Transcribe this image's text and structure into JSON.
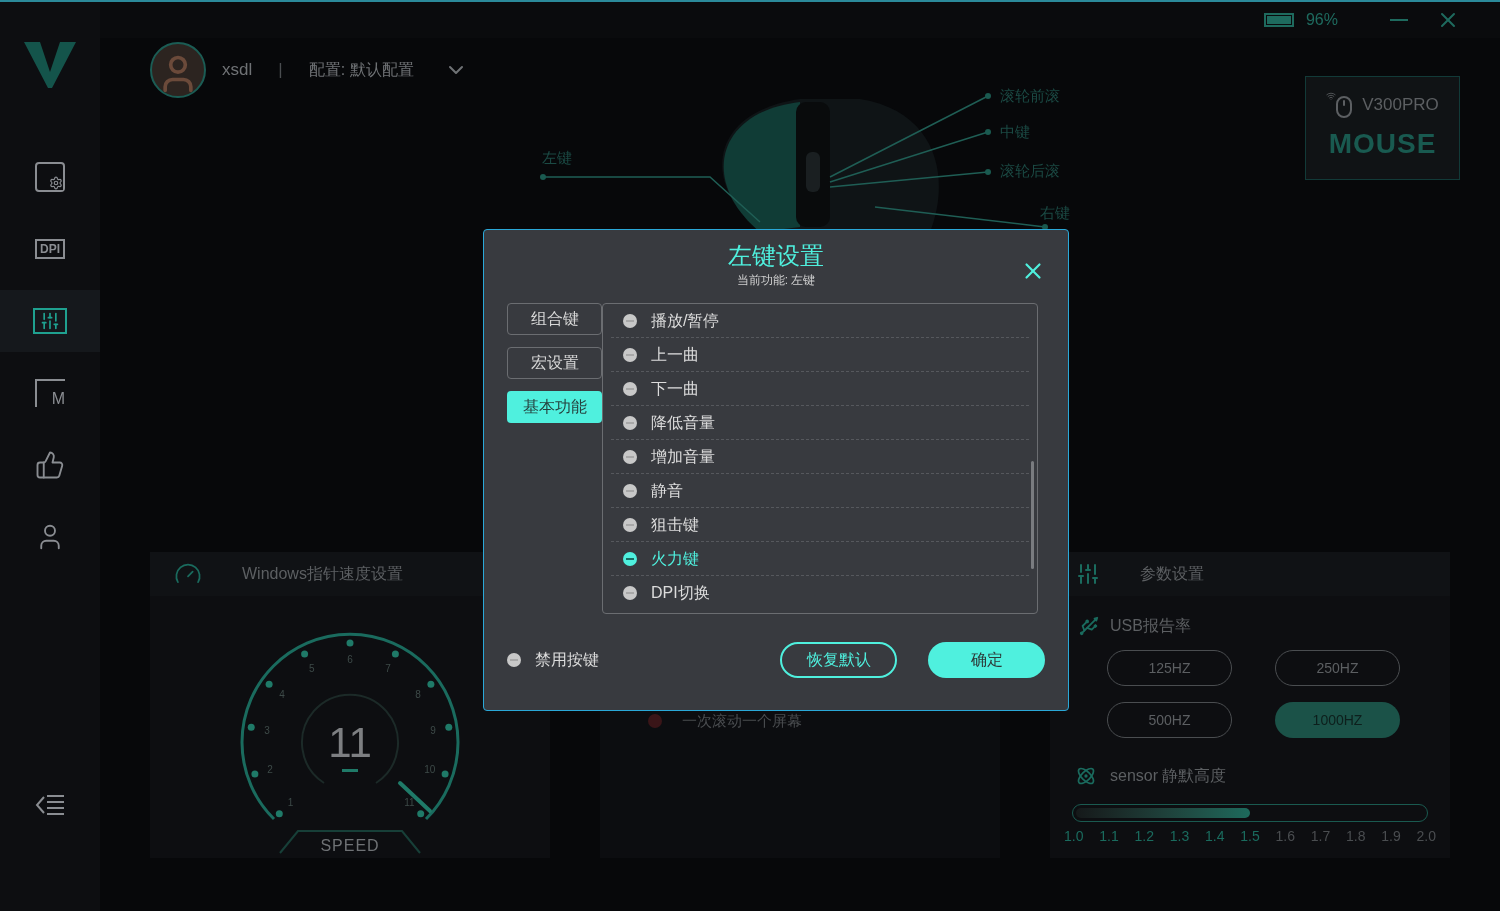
{
  "window": {
    "battery": "96%"
  },
  "sidebar": {
    "items": [
      {
        "kind": "frame-gear",
        "selected": false
      },
      {
        "kind": "dpi",
        "label": "DPI",
        "selected": false
      },
      {
        "kind": "sliders",
        "selected": true
      },
      {
        "kind": "macro",
        "label": "M",
        "selected": false
      },
      {
        "kind": "thumbs-up",
        "selected": false
      },
      {
        "kind": "user",
        "selected": false
      }
    ]
  },
  "header": {
    "user": "xsdl",
    "separator": "|",
    "profile": "配置: 默认配置"
  },
  "device": {
    "model": "V300PRO",
    "type": "MOUSE"
  },
  "mouse_buttons": [
    {
      "label": "左键"
    },
    {
      "label": "滚轮前滚"
    },
    {
      "label": "中键"
    },
    {
      "label": "滚轮后滚"
    },
    {
      "label": "右键"
    }
  ],
  "pointer_speed": {
    "title": "Windows指针速度设置",
    "ticks": [
      "1",
      "2",
      "3",
      "4",
      "5",
      "6",
      "7",
      "8",
      "9",
      "10",
      "11"
    ],
    "value": "11",
    "caption": "SPEED"
  },
  "scroll_speed": {
    "options": [
      {
        "label": "一次滚动一个屏幕",
        "selected": false
      }
    ]
  },
  "parameters": {
    "title": "参数设置",
    "usb_rate": {
      "label": "USB报告率",
      "options": [
        {
          "label": "125HZ",
          "selected": false
        },
        {
          "label": "250HZ",
          "selected": false
        },
        {
          "label": "500HZ",
          "selected": false
        },
        {
          "label": "1000HZ",
          "selected": true
        }
      ]
    },
    "sensor": {
      "label": "sensor 静默高度",
      "level": 0.5,
      "ticks": [
        "1.0",
        "1.1",
        "1.2",
        "1.3",
        "1.4",
        "1.5",
        "1.6",
        "1.7",
        "1.8",
        "1.9",
        "2.0"
      ]
    }
  },
  "dialog": {
    "title": "左键设置",
    "subtitle": "当前功能: 左键",
    "tabs": [
      {
        "label": "组合键",
        "selected": false
      },
      {
        "label": "宏设置",
        "selected": false
      },
      {
        "label": "基本功能",
        "selected": true
      }
    ],
    "functions": [
      {
        "label": "播放/暂停",
        "selected": false
      },
      {
        "label": "上一曲",
        "selected": false
      },
      {
        "label": "下一曲",
        "selected": false
      },
      {
        "label": "降低音量",
        "selected": false
      },
      {
        "label": "增加音量",
        "selected": false
      },
      {
        "label": "静音",
        "selected": false
      },
      {
        "label": "狙击键",
        "selected": false
      },
      {
        "label": "火力键",
        "selected": true
      },
      {
        "label": "DPI切换",
        "selected": false
      }
    ],
    "disable": {
      "label": "禁用按键",
      "selected": false
    },
    "buttons": [
      {
        "label": "恢复默认",
        "kind": "outline"
      },
      {
        "label": "确定",
        "kind": "primary"
      }
    ]
  }
}
